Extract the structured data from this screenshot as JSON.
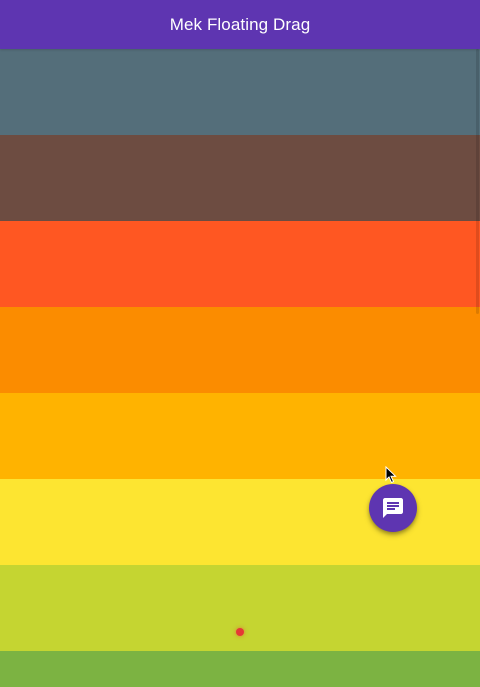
{
  "app_bar": {
    "title": "Mek Floating Drag",
    "color": "#5e35b1"
  },
  "list": {
    "bands": [
      {
        "name": "blue-grey",
        "color": "#546e7a"
      },
      {
        "name": "brown",
        "color": "#6d4c41"
      },
      {
        "name": "deep-orange",
        "color": "#ff5722"
      },
      {
        "name": "orange",
        "color": "#fb8c00"
      },
      {
        "name": "amber",
        "color": "#ffb300"
      },
      {
        "name": "yellow",
        "color": "#fde531"
      },
      {
        "name": "lime",
        "color": "#c5d531"
      },
      {
        "name": "light-green",
        "color": "#7cb342"
      }
    ]
  },
  "fab": {
    "icon": "message-icon",
    "color": "#5e35b1"
  },
  "cursor": {
    "icon": "mouse-pointer-icon"
  },
  "touch_indicator": {
    "color": "#e53935"
  }
}
